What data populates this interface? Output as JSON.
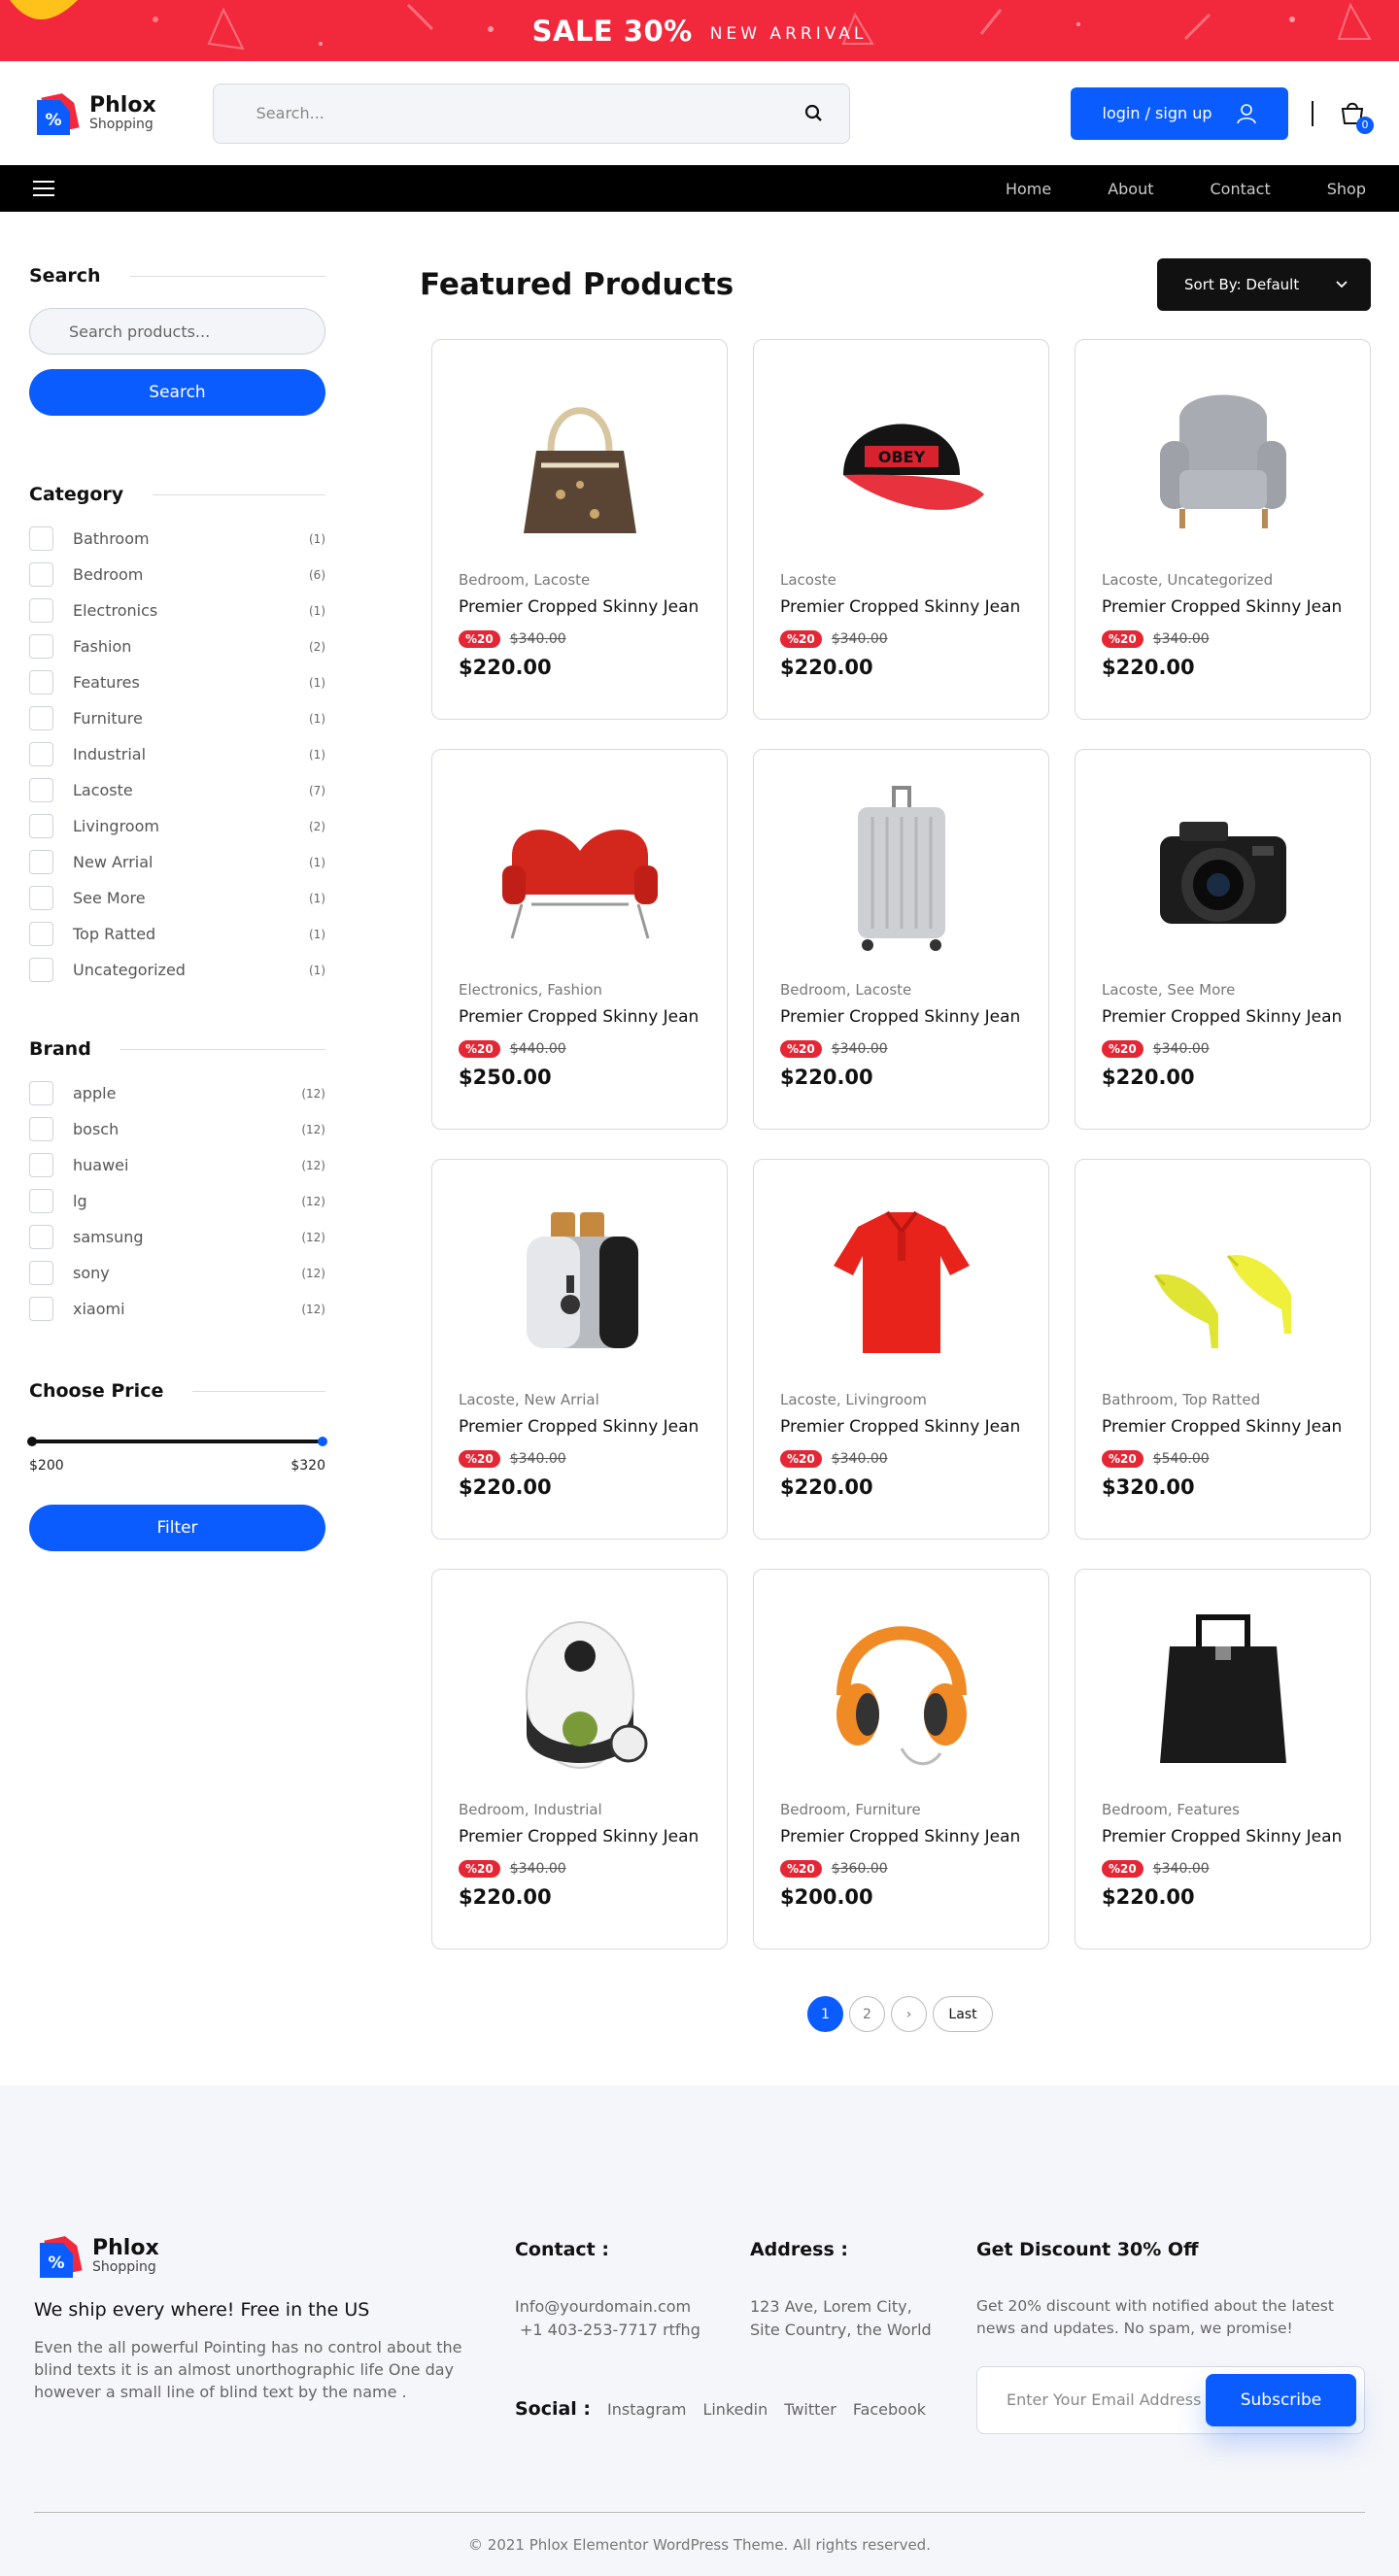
{
  "promo": {
    "sale": "SALE 30%",
    "tag": "NEW ARRIVAL"
  },
  "brand": {
    "name": "Phlox",
    "sub": "Shopping"
  },
  "header": {
    "search_placeholder": "Search...",
    "login": "login / sign up",
    "cart_count": "0"
  },
  "nav": {
    "links": [
      "Home",
      "About",
      "Contact",
      "Shop"
    ]
  },
  "sidebar": {
    "search_title": "Search",
    "search_placeholder": "Search products...",
    "search_button": "Search",
    "category_title": "Category",
    "categories": [
      {
        "name": "Bathroom",
        "count": "(1)"
      },
      {
        "name": "Bedroom",
        "count": "(6)"
      },
      {
        "name": "Electronics",
        "count": "(1)"
      },
      {
        "name": "Fashion",
        "count": "(2)"
      },
      {
        "name": "Features",
        "count": "(1)"
      },
      {
        "name": "Furniture",
        "count": "(1)"
      },
      {
        "name": "Industrial",
        "count": "(1)"
      },
      {
        "name": "Lacoste",
        "count": "(7)"
      },
      {
        "name": "Livingroom",
        "count": "(2)"
      },
      {
        "name": "New Arrial",
        "count": "(1)"
      },
      {
        "name": "See More",
        "count": "(1)"
      },
      {
        "name": "Top Ratted",
        "count": "(1)"
      },
      {
        "name": "Uncategorized",
        "count": "(1)"
      }
    ],
    "brand_title": "Brand",
    "brands": [
      {
        "name": "apple",
        "count": "(12)"
      },
      {
        "name": "bosch",
        "count": "(12)"
      },
      {
        "name": "huawei",
        "count": "(12)"
      },
      {
        "name": "lg",
        "count": "(12)"
      },
      {
        "name": "samsung",
        "count": "(12)"
      },
      {
        "name": "sony",
        "count": "(12)"
      },
      {
        "name": "xiaomi",
        "count": "(12)"
      }
    ],
    "price_title": "Choose Price",
    "price_min": "$200",
    "price_max": "$320",
    "filter_button": "Filter"
  },
  "content": {
    "title": "Featured Products",
    "sort": "Sort By: Default"
  },
  "products": [
    {
      "icon": "handbag-icon",
      "cats": "Bedroom, Lacoste",
      "title": "Premier Cropped Skinny Jean",
      "off": "%20",
      "old": "$340.00",
      "price": "$220.00"
    },
    {
      "icon": "cap-icon",
      "cats": "Lacoste",
      "title": "Premier Cropped Skinny Jean",
      "off": "%20",
      "old": "$340.00",
      "price": "$220.00"
    },
    {
      "icon": "armchair-icon",
      "cats": "Lacoste, Uncategorized",
      "title": "Premier Cropped Skinny Jean",
      "off": "%20",
      "old": "$340.00",
      "price": "$220.00"
    },
    {
      "icon": "sofa-icon",
      "cats": "Electronics, Fashion",
      "title": "Premier Cropped Skinny Jean",
      "off": "%20",
      "old": "$440.00",
      "price": "$250.00"
    },
    {
      "icon": "suitcase-icon",
      "cats": "Bedroom, Lacoste",
      "title": "Premier Cropped Skinny Jean",
      "off": "%20",
      "old": "$340.00",
      "price": "$220.00"
    },
    {
      "icon": "camera-icon",
      "cats": "Lacoste, See More",
      "title": "Premier Cropped Skinny Jean",
      "off": "%20",
      "old": "$340.00",
      "price": "$220.00"
    },
    {
      "icon": "toaster-icon",
      "cats": "Lacoste, New Arrial",
      "title": "Premier Cropped Skinny Jean",
      "off": "%20",
      "old": "$340.00",
      "price": "$220.00"
    },
    {
      "icon": "shirt-icon",
      "cats": "Lacoste, Livingroom",
      "title": "Premier Cropped Skinny Jean",
      "off": "%20",
      "old": "$340.00",
      "price": "$220.00"
    },
    {
      "icon": "heels-icon",
      "cats": "Bathroom, Top Ratted",
      "title": "Premier Cropped Skinny Jean",
      "off": "%20",
      "old": "$540.00",
      "price": "$320.00"
    },
    {
      "icon": "vacuum-icon",
      "cats": "Bedroom, Industrial",
      "title": "Premier Cropped Skinny Jean",
      "off": "%20",
      "old": "$340.00",
      "price": "$220.00"
    },
    {
      "icon": "headphones-icon",
      "cats": "Bedroom, Furniture",
      "title": "Premier Cropped Skinny Jean",
      "off": "%20",
      "old": "$360.00",
      "price": "$200.00"
    },
    {
      "icon": "tote-bag-icon",
      "cats": "Bedroom, Features",
      "title": "Premier Cropped Skinny Jean",
      "off": "%20",
      "old": "$340.00",
      "price": "$220.00"
    }
  ],
  "pagination": {
    "pages": [
      "1",
      "2"
    ],
    "next": "›",
    "last": "Last"
  },
  "footer": {
    "ship": "We ship every where! Free in the US",
    "desc": "Even the all powerful Pointing has no control about the blind texts it is an almost unorthographic life One day however a small line of blind text by the name .",
    "contact_title": "Contact :",
    "email": "Info@yourdomain.com",
    "phone": "+1 403-253-7717 rtfhg",
    "address_title": "Address :",
    "address1": "123 Ave, Lorem City,",
    "address2": "Site Country, the World",
    "social_title": "Social :",
    "social": [
      "Instagram",
      "Linkedin",
      "Twitter",
      "Facebook"
    ],
    "discount_title": "Get Discount 30% Off",
    "discount_text": "Get 20% discount with notified about the latest news and updates. No spam, we promise!",
    "email_placeholder": "Enter Your Email Address",
    "subscribe": "Subscribe",
    "copyright": "© 2021 Phlox Elementor WordPress Theme. All rights reserved."
  },
  "colors": {
    "accent": "#0a5cff",
    "promo": "#f2283c",
    "badge": "#e52635",
    "dark": "#111111"
  }
}
